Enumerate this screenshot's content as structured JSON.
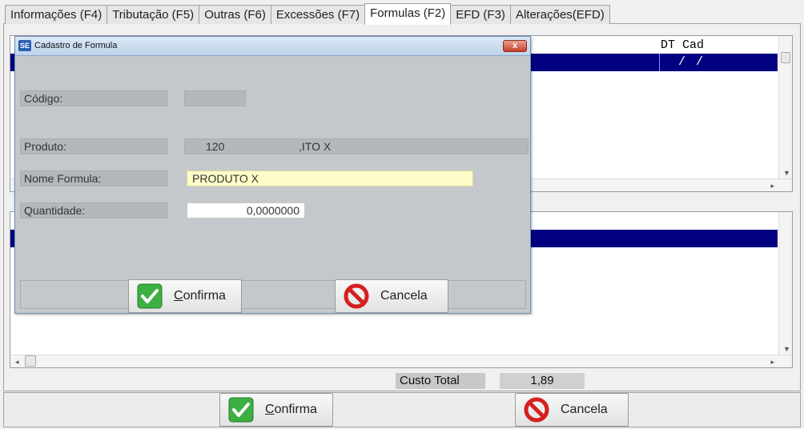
{
  "tabs": [
    {
      "label": "Informações (F4)",
      "active": false
    },
    {
      "label": "Tributação (F5)",
      "active": false
    },
    {
      "label": "Outras (F6)",
      "active": false
    },
    {
      "label": "Excessões (F7)",
      "active": false
    },
    {
      "label": "Formulas (F2)",
      "active": true
    },
    {
      "label": "EFD (F3)",
      "active": false
    },
    {
      "label": "Alterações(EFD)",
      "active": false
    }
  ],
  "grid_top": {
    "header_dt_cad": "DT Cad",
    "selected_row_date": "/  /"
  },
  "totals": {
    "custo_label": "Custo Total",
    "custo_value": "1,89"
  },
  "main_buttons": {
    "confirma": "onfirma",
    "confirma_hotkey": "C",
    "cancela": "Cancela"
  },
  "dialog": {
    "title": "Cadastro de Formula",
    "close": "x",
    "codigo_label": "Código:",
    "codigo_value": "",
    "produto_label": "Produto:",
    "produto_code": "120",
    "produto_name": ",ITO X",
    "nome_label": "Nome Formula:",
    "nome_value": "PRODUTO X",
    "quantidade_label": "Quantidade:",
    "quantidade_value": "0,0000000",
    "confirma": "onfirma",
    "confirma_hotkey": "C",
    "cancela": "Cancela"
  },
  "colors": {
    "selection": "#000080",
    "highlight_field": "#fefcc8",
    "confirm_green": "#3cb043",
    "cancel_red": "#d42020"
  }
}
